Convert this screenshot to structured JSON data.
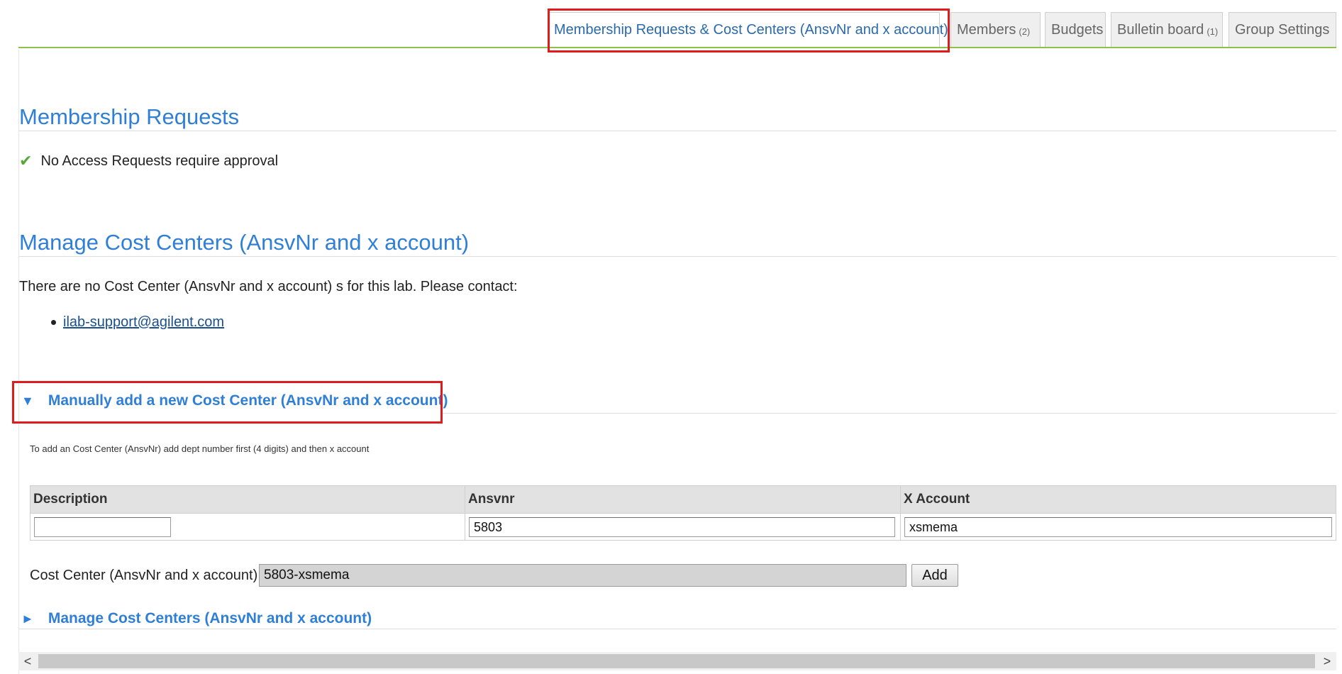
{
  "tabs": [
    {
      "label": "Membership Requests & Cost Centers (AnsvNr and x account)",
      "count": "",
      "active": true
    },
    {
      "label": "Members",
      "count": "(2)",
      "active": false
    },
    {
      "label": "Budgets",
      "count": "",
      "active": false
    },
    {
      "label": "Bulletin board",
      "count": "(1)",
      "active": false
    },
    {
      "label": "Group Settings",
      "count": "",
      "active": false
    }
  ],
  "membership": {
    "title": "Membership Requests",
    "notice": "No Access Requests require approval"
  },
  "cost_centers": {
    "title": "Manage Cost Centers (AnsvNr and x account)",
    "empty_message": "There are no Cost Center (AnsvNr and x account) s for this lab. Please contact:",
    "contact_email": "ilab-support@agilent.com"
  },
  "manual_add": {
    "toggle_label": "Manually add a new Cost Center (AnsvNr and x account)",
    "hint": "To add an Cost Center (AnsvNr) add dept number first (4 digits) and then x account",
    "columns": [
      "Description",
      "Ansvnr",
      "X Account"
    ],
    "values": {
      "description": "",
      "ansvnr": "5803",
      "x_account": "xsmema"
    },
    "result_label": "Cost Center (AnsvNr and x account) :",
    "result_value": "5803-xsmema",
    "add_button": "Add"
  },
  "manage_toggle_label": "Manage Cost Centers (AnsvNr and x account)",
  "icons": {
    "check": "check-icon",
    "expand": "triangle-down-icon",
    "collapse": "triangle-right-icon"
  },
  "colors": {
    "accent": "#2f7fd6",
    "tab_line": "#8bc34a",
    "highlight": "#e01b1b",
    "check": "#57a83a"
  }
}
